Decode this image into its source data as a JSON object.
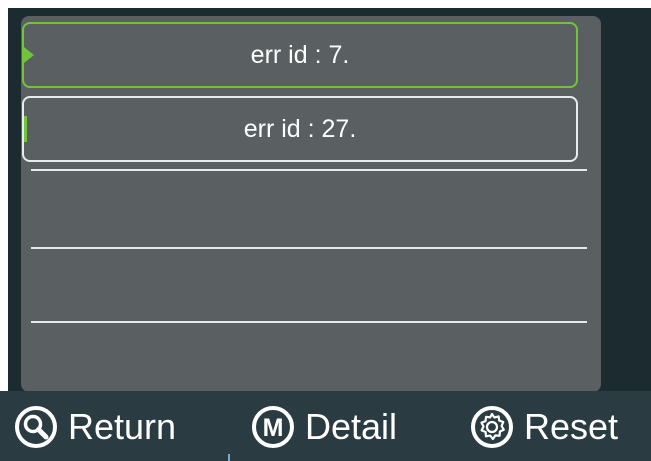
{
  "error_list": {
    "items": [
      {
        "label": "err  id : 7.",
        "selected": true
      },
      {
        "label": "err  id : 27.",
        "selected": false
      }
    ]
  },
  "footer": {
    "return_label": "Return",
    "detail_label": "Detail",
    "reset_label": "Reset",
    "detail_icon_letter": "M"
  },
  "colors": {
    "panel": "#5a5f61",
    "screen_bg": "#1c2b30",
    "footer_bg": "#2a3c42",
    "selected_accent": "#72c43a",
    "text": "#ffffff"
  },
  "icons": {
    "return": "search-icon",
    "detail": "m-circle-icon",
    "reset": "gear-icon"
  }
}
